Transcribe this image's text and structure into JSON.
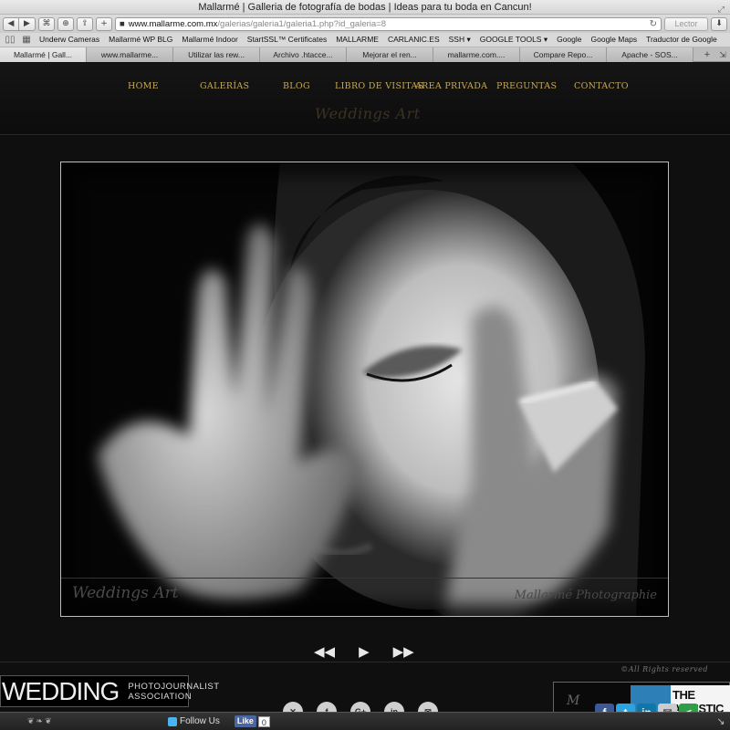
{
  "window": {
    "title": "Mallarmé | Galleria de fotografía de bodas | Ideas para tu boda en Cancun!"
  },
  "toolbar": {
    "back_glyph": "◀",
    "forward_glyph": "▶",
    "url_host": "www.mallarme.com.mx",
    "url_path": "/galerias/galeria1/galeria1.php?id_galeria=8",
    "reader_label": "Lector",
    "add_glyph": "+"
  },
  "bookmarks": [
    "Underw Cameras",
    "Mallarmé WP BLG",
    "Mallarmé Indoor",
    "StartSSL™ Certificates",
    "MALLARME",
    "CARLANIC.ES",
    "SSH ▾",
    "GOOGLE TOOLS ▾",
    "Google",
    "Google Maps",
    "Traductor de Google"
  ],
  "tabs": [
    "Mallarmé | Gall...",
    "www.mallarme...",
    "Utilizar las rew...",
    "Archivo .htacce...",
    "Mejorar el ren...",
    "mallarme.com....",
    "Compare Repo...",
    "Apache - SOS..."
  ],
  "nav": [
    "HOME",
    "GALERÍAS",
    "BLOG",
    "LIBRO DE VISITAS",
    "AREA PRIVADA",
    "PREGUNTAS",
    "CONTACTO"
  ],
  "site_logo": "Weddings Art",
  "photo": {
    "watermark_left": "Weddings Art",
    "watermark_right": "Mallarmé Photographie"
  },
  "controls": {
    "prev": "◀◀",
    "play": "▶",
    "next": "▶▶"
  },
  "rights": "©All Rights reserved",
  "wpja": {
    "big": "WEDDING",
    "line1": "PHOTOJOURNALIST",
    "line2": "ASSOCIATION"
  },
  "social_round": [
    "✕",
    "f",
    "G+",
    "in",
    "✉"
  ],
  "artistic": {
    "signature": "M",
    "text": "THE ARTISTIC GUILD"
  },
  "sharebar": [
    {
      "glyph": "f",
      "color": "#3b5998"
    },
    {
      "glyph": "t",
      "color": "#2aa3e0"
    },
    {
      "glyph": "in",
      "color": "#0e76a8"
    },
    {
      "glyph": "✉",
      "color": "#cccccc"
    },
    {
      "glyph": "<",
      "color": "#2f9e44"
    }
  ],
  "status": {
    "follow_label": "Follow Us",
    "like_label": "Like",
    "like_count": "0"
  },
  "colors": {
    "nav_gold": "#c8a951",
    "page_bg": "#0f0f0f"
  }
}
